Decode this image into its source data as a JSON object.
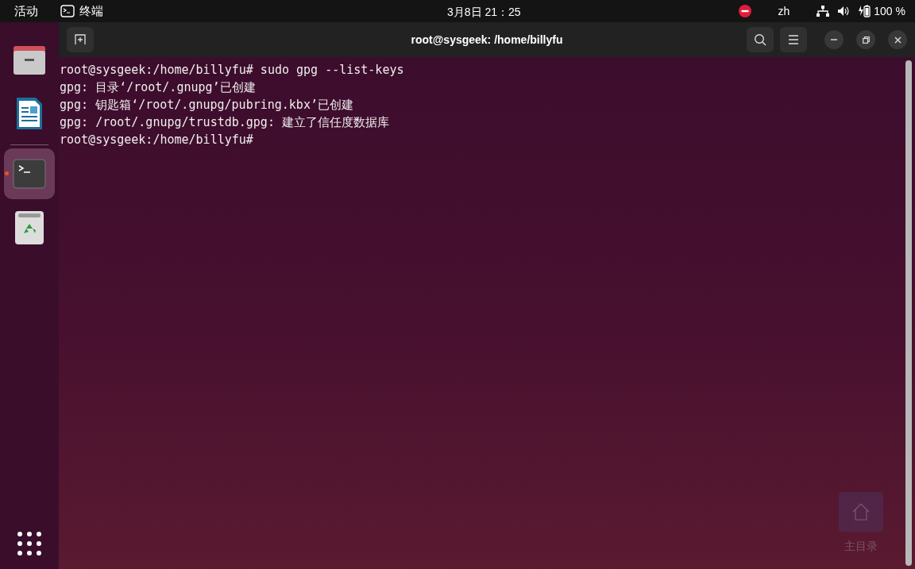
{
  "top_bar": {
    "activities": "活动",
    "app_menu": "终端",
    "clock": "3月8日 21：25",
    "input_method": "zh",
    "battery": "100 %"
  },
  "dock": {
    "items": [
      {
        "kind": "files",
        "selected": false
      },
      {
        "kind": "writer",
        "selected": false
      },
      {
        "kind": "terminal",
        "selected": true
      },
      {
        "kind": "trash",
        "selected": false
      }
    ]
  },
  "window": {
    "title": "root@sysgeek: /home/billyfu",
    "lines": [
      "root@sysgeek:/home/billyfu# sudo gpg --list-keys",
      "gpg: 目录‘/root/.gnupg’已创建",
      "gpg: 钥匙箱‘/root/.gnupg/pubring.kbx’已创建",
      "gpg: /root/.gnupg/trustdb.gpg: 建立了信任度数据库",
      "root@sysgeek:/home/billyfu#"
    ]
  },
  "desktop_icon": {
    "label": "主目录"
  }
}
